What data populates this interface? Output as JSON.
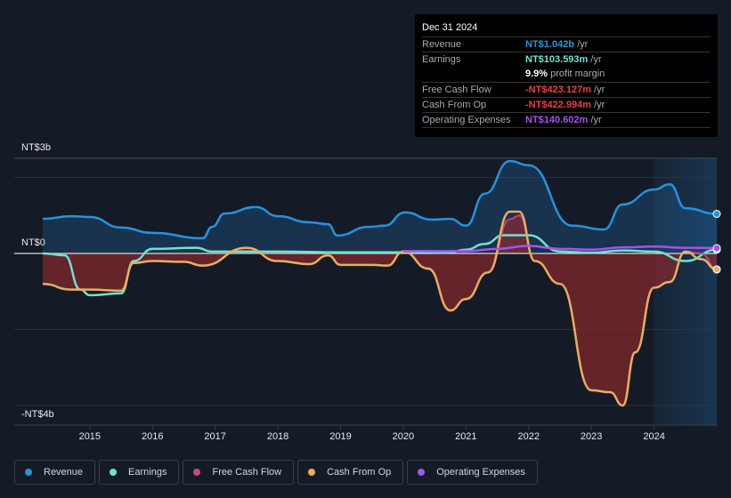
{
  "tooltip": {
    "date": "Dec 31 2024",
    "rows": [
      {
        "label": "Revenue",
        "value": "NT$1.042b",
        "unit": " /yr",
        "color": "#2394df"
      },
      {
        "label": "Earnings",
        "value": "NT$103.593m",
        "unit": " /yr",
        "color": "#6ce3d2"
      },
      {
        "label": "",
        "value": "9.9%",
        "unit": " profit margin",
        "color": "#ffffff"
      },
      {
        "label": "Free Cash Flow",
        "value": "-NT$423.127m",
        "unit": " /yr",
        "color": "#e64141"
      },
      {
        "label": "Cash From Op",
        "value": "-NT$422.994m",
        "unit": " /yr",
        "color": "#e64141"
      },
      {
        "label": "Operating Expenses",
        "value": "NT$140.602m",
        "unit": " /yr",
        "color": "#a553ef"
      }
    ]
  },
  "legend": [
    {
      "label": "Revenue",
      "color": "#2394df"
    },
    {
      "label": "Earnings",
      "color": "#6ce3d2"
    },
    {
      "label": "Free Cash Flow",
      "color": "#c4487f"
    },
    {
      "label": "Cash From Op",
      "color": "#e8ae5e"
    },
    {
      "label": "Operating Expenses",
      "color": "#a553ef"
    }
  ],
  "chart_data": {
    "type": "line",
    "title": "",
    "xlabel": "",
    "ylabel": "",
    "y_tick_labels": [
      "NT$3b",
      "NT$0",
      "-NT$4b"
    ],
    "x_tick_labels": [
      "2015",
      "2016",
      "2017",
      "2018",
      "2019",
      "2020",
      "2021",
      "2022",
      "2023",
      "2024"
    ],
    "xlim": [
      2014.25,
      2025.0
    ],
    "ylim": [
      -4.4,
      2.5
    ],
    "units": "NT$ billions",
    "highlight_from": 2024.0,
    "grid": true,
    "legend_position": "bottom",
    "series": [
      {
        "name": "Revenue",
        "color": "#2394df",
        "fill": true,
        "x": [
          2014.25,
          2014.7,
          2015.0,
          2015.5,
          2016.0,
          2016.8,
          2016.95,
          2017.15,
          2017.65,
          2018.0,
          2018.5,
          2018.8,
          2018.95,
          2019.45,
          2019.7,
          2020.03,
          2020.45,
          2020.75,
          2021.0,
          2021.3,
          2021.7,
          2022.0,
          2022.7,
          2023.2,
          2023.5,
          2024.0,
          2024.25,
          2024.5,
          2025.0
        ],
        "y": [
          0.91,
          0.98,
          0.96,
          0.68,
          0.54,
          0.4,
          0.7,
          1.05,
          1.22,
          0.98,
          0.82,
          0.77,
          0.47,
          0.7,
          0.73,
          1.08,
          0.89,
          0.91,
          0.73,
          1.57,
          2.43,
          2.32,
          0.73,
          0.63,
          1.29,
          1.68,
          1.82,
          1.19,
          1.04
        ]
      },
      {
        "name": "Earnings",
        "color": "#6ce3d2",
        "fill": false,
        "x": [
          2014.25,
          2014.6,
          2014.85,
          2015.0,
          2015.5,
          2015.7,
          2016.0,
          2016.7,
          2016.95,
          2017.5,
          2018.0,
          2019.0,
          2020.0,
          2020.7,
          2021.0,
          2021.3,
          2021.6,
          2022.0,
          2022.5,
          2023.0,
          2023.5,
          2024.0,
          2024.5,
          2025.0
        ],
        "y": [
          0.0,
          -0.05,
          -0.95,
          -1.1,
          -1.05,
          -0.2,
          0.12,
          0.15,
          0.05,
          0.05,
          0.05,
          0.03,
          0.03,
          0.02,
          0.1,
          0.25,
          0.48,
          0.48,
          0.05,
          0.02,
          0.08,
          0.05,
          -0.2,
          0.1
        ]
      },
      {
        "name": "Free Cash Flow",
        "color": "#c4487f",
        "fill": true,
        "x": [
          2014.25,
          2014.7,
          2015.0,
          2015.5,
          2015.7,
          2016.0,
          2016.5,
          2016.8,
          2017.5,
          2018.0,
          2018.5,
          2018.8,
          2019.0,
          2019.5,
          2019.75,
          2020.0,
          2020.4,
          2020.75,
          2021.0,
          2021.35,
          2021.7,
          2021.85,
          2022.1,
          2022.5,
          2023.0,
          2023.3,
          2023.5,
          2023.7,
          2024.0,
          2024.25,
          2024.5,
          2024.75,
          2025.0
        ],
        "y": [
          -0.8,
          -0.95,
          -0.95,
          -0.98,
          -0.25,
          -0.2,
          -0.22,
          -0.32,
          0.15,
          -0.2,
          -0.28,
          -0.05,
          -0.3,
          -0.3,
          -0.32,
          0.05,
          -0.4,
          -1.5,
          -1.2,
          -0.5,
          0.9,
          1.0,
          -0.2,
          -0.8,
          -3.6,
          -3.65,
          -4.0,
          -2.6,
          -0.9,
          -0.75,
          0.05,
          0.0,
          -0.42
        ]
      },
      {
        "name": "Cash From Op",
        "color": "#e8ae5e",
        "fill": false,
        "x": [
          2014.25,
          2014.7,
          2015.0,
          2015.5,
          2015.7,
          2016.0,
          2016.5,
          2016.8,
          2017.5,
          2018.0,
          2018.5,
          2018.8,
          2019.0,
          2019.5,
          2019.75,
          2020.0,
          2020.4,
          2020.75,
          2021.0,
          2021.35,
          2021.7,
          2021.85,
          2022.1,
          2022.5,
          2023.0,
          2023.3,
          2023.5,
          2023.7,
          2024.0,
          2024.25,
          2024.5,
          2024.75,
          2025.0
        ],
        "y": [
          -0.8,
          -0.95,
          -0.95,
          -0.98,
          -0.25,
          -0.2,
          -0.22,
          -0.32,
          0.15,
          -0.2,
          -0.28,
          -0.05,
          -0.3,
          -0.3,
          -0.32,
          0.05,
          -0.4,
          -1.5,
          -1.2,
          -0.5,
          1.1,
          1.1,
          -0.2,
          -0.8,
          -3.6,
          -3.65,
          -4.0,
          -2.6,
          -0.9,
          -0.75,
          0.05,
          -0.15,
          -0.42
        ]
      },
      {
        "name": "Operating Expenses",
        "color": "#a553ef",
        "fill": false,
        "x": [
          2020.0,
          2020.5,
          2021.0,
          2021.5,
          2022.0,
          2022.5,
          2023.0,
          2023.5,
          2024.0,
          2024.5,
          2025.0
        ],
        "y": [
          0.06,
          0.06,
          0.06,
          0.12,
          0.2,
          0.12,
          0.1,
          0.16,
          0.18,
          0.15,
          0.14
        ]
      }
    ]
  }
}
